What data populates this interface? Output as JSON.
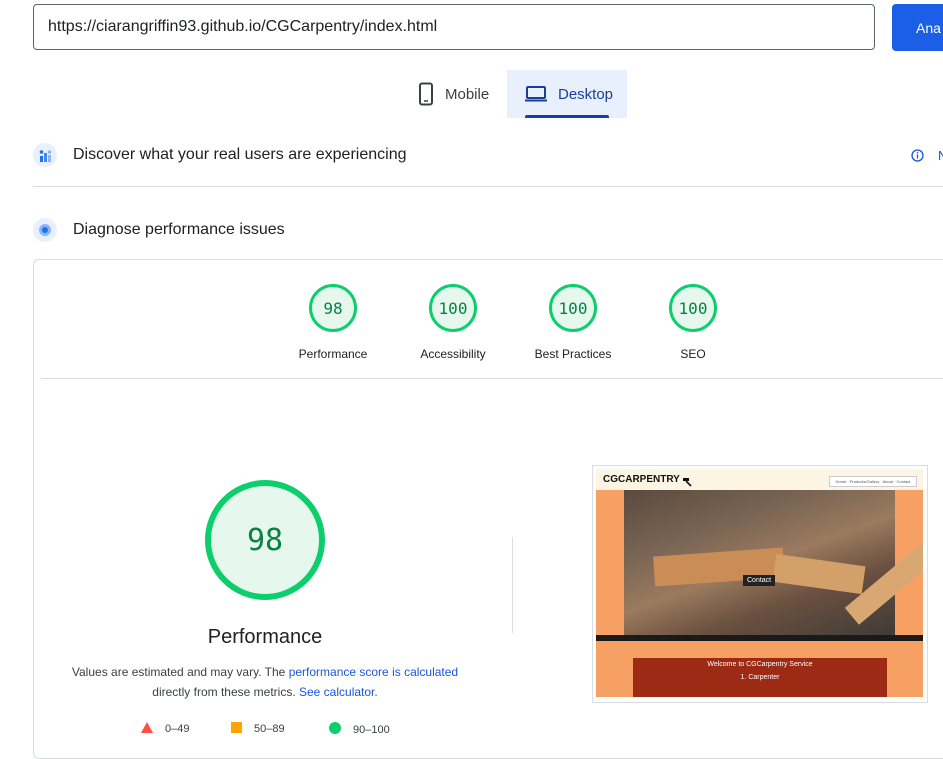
{
  "url_bar": {
    "value": "https://ciarangriffin93.github.io/CGCarpentry/index.html",
    "analyze_label": "Ana"
  },
  "device_tabs": {
    "mobile": "Mobile",
    "desktop": "Desktop",
    "selected": "Desktop"
  },
  "sections": {
    "real_users": {
      "title": "Discover what your real users are experiencing",
      "link_fragment": "N"
    },
    "diagnose": {
      "title": "Diagnose performance issues"
    }
  },
  "scores": [
    {
      "label": "Performance",
      "value": "98"
    },
    {
      "label": "Accessibility",
      "value": "100"
    },
    {
      "label": "Best Practices",
      "value": "100"
    },
    {
      "label": "SEO",
      "value": "100"
    }
  ],
  "performance": {
    "score": "98",
    "title": "Performance",
    "note_text": "Values are estimated and may vary. The",
    "note_link": "performance score is calculated",
    "note_text2": "directly from these metrics.",
    "calculator_link": "See calculator."
  },
  "legend": [
    {
      "range": "0–49",
      "color": "#ff4e42",
      "shape": "triangle"
    },
    {
      "range": "50–89",
      "color": "#ffa400",
      "shape": "square"
    },
    {
      "range": "90–100",
      "color": "#0cce6b",
      "shape": "circle"
    }
  ],
  "screenshot": {
    "brand": "CGCARPENTRY",
    "nav_links": "Home · Products/Gallery · About · Contact",
    "contact_label": "Contact",
    "welcome": "Welcome to CGCarpentry Service",
    "heading": "1. Carpenter"
  },
  "colors": {
    "accent": "#1a56db",
    "pass": "#0cce6b"
  }
}
